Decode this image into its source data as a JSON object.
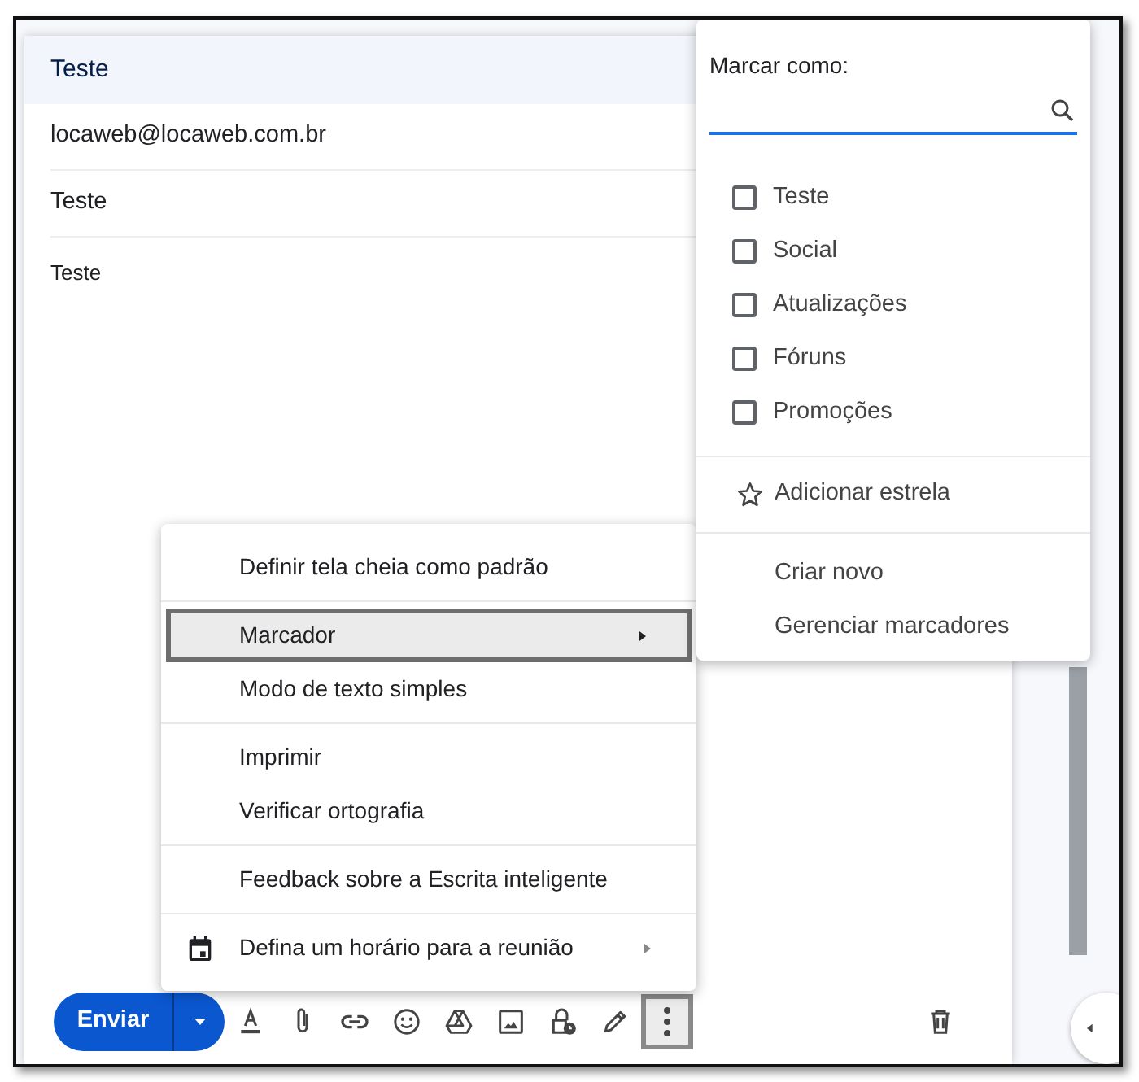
{
  "compose": {
    "header": "Teste",
    "to": "locaweb@locaweb.com.br",
    "subject": "Teste",
    "body": "Teste"
  },
  "more_menu": {
    "groups": [
      [
        {
          "kind": "plain",
          "label": "Definir tela cheia como padrão",
          "selected": false,
          "submenu": false
        }
      ],
      [
        {
          "kind": "plain",
          "label": "Marcador",
          "selected": true,
          "submenu": true
        },
        {
          "kind": "plain",
          "label": "Modo de texto simples",
          "selected": false,
          "submenu": false
        }
      ],
      [
        {
          "kind": "plain",
          "label": "Imprimir",
          "selected": false,
          "submenu": false
        },
        {
          "kind": "plain",
          "label": "Verificar ortografia",
          "selected": false,
          "submenu": false
        }
      ],
      [
        {
          "kind": "plain",
          "label": "Feedback sobre a Escrita inteligente",
          "selected": false,
          "submenu": false
        }
      ],
      [
        {
          "kind": "calendar",
          "label": "Defina um horário para a reunião",
          "selected": false,
          "submenu": true
        }
      ]
    ]
  },
  "label_menu": {
    "title": "Marcar como:",
    "labels": [
      {
        "label": "Teste",
        "checked": false
      },
      {
        "label": "Social",
        "checked": false
      },
      {
        "label": "Atualizações",
        "checked": false
      },
      {
        "label": "Fóruns",
        "checked": false
      },
      {
        "label": "Promoções",
        "checked": false
      }
    ],
    "star_action": "Adicionar estrela",
    "actions": [
      "Criar novo",
      "Gerenciar marcadores"
    ]
  },
  "toolbar": {
    "send": "Enviar",
    "more_options_selected": true
  }
}
